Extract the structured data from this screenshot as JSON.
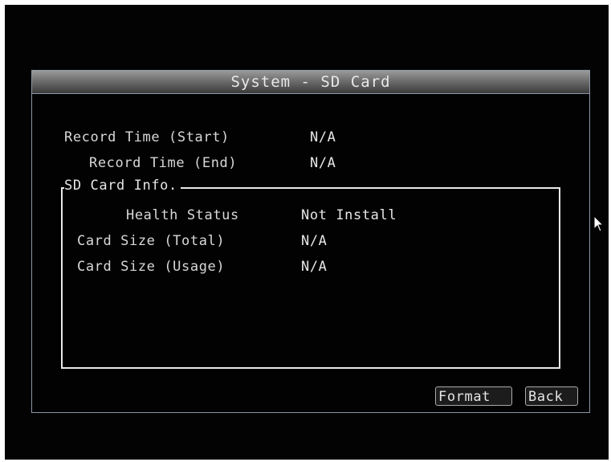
{
  "dialog": {
    "title": "System - SD Card"
  },
  "record": {
    "start_label": "Record Time (Start)",
    "start_value": "N/A",
    "end_label": "Record Time (End)",
    "end_value": "N/A"
  },
  "sd_info": {
    "legend": "SD Card Info.",
    "health_label": "Health Status",
    "health_value": "Not Install",
    "total_label": "Card Size (Total)",
    "total_value": "N/A",
    "usage_label": "Card Size (Usage)",
    "usage_value": "N/A"
  },
  "buttons": {
    "format_label": "Format",
    "back_label": "Back"
  },
  "icons": {
    "cursor": "mouse-pointer-icon"
  },
  "colors": {
    "background": "#030303",
    "text": "#d8d8d8",
    "titlebar": "#6e6e6e",
    "border": "#8a96a8"
  }
}
